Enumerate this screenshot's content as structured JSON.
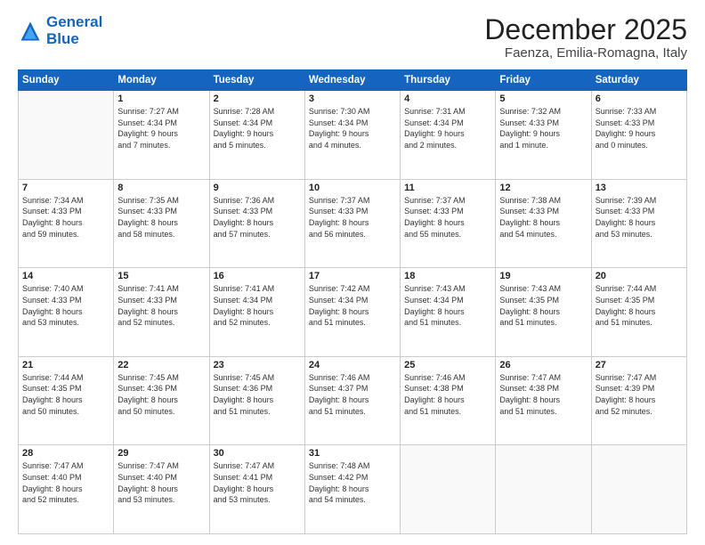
{
  "header": {
    "logo_line1": "General",
    "logo_line2": "Blue",
    "month": "December 2025",
    "location": "Faenza, Emilia-Romagna, Italy"
  },
  "weekdays": [
    "Sunday",
    "Monday",
    "Tuesday",
    "Wednesday",
    "Thursday",
    "Friday",
    "Saturday"
  ],
  "weeks": [
    [
      {
        "day": "",
        "info": ""
      },
      {
        "day": "1",
        "info": "Sunrise: 7:27 AM\nSunset: 4:34 PM\nDaylight: 9 hours\nand 7 minutes."
      },
      {
        "day": "2",
        "info": "Sunrise: 7:28 AM\nSunset: 4:34 PM\nDaylight: 9 hours\nand 5 minutes."
      },
      {
        "day": "3",
        "info": "Sunrise: 7:30 AM\nSunset: 4:34 PM\nDaylight: 9 hours\nand 4 minutes."
      },
      {
        "day": "4",
        "info": "Sunrise: 7:31 AM\nSunset: 4:34 PM\nDaylight: 9 hours\nand 2 minutes."
      },
      {
        "day": "5",
        "info": "Sunrise: 7:32 AM\nSunset: 4:33 PM\nDaylight: 9 hours\nand 1 minute."
      },
      {
        "day": "6",
        "info": "Sunrise: 7:33 AM\nSunset: 4:33 PM\nDaylight: 9 hours\nand 0 minutes."
      }
    ],
    [
      {
        "day": "7",
        "info": "Sunrise: 7:34 AM\nSunset: 4:33 PM\nDaylight: 8 hours\nand 59 minutes."
      },
      {
        "day": "8",
        "info": "Sunrise: 7:35 AM\nSunset: 4:33 PM\nDaylight: 8 hours\nand 58 minutes."
      },
      {
        "day": "9",
        "info": "Sunrise: 7:36 AM\nSunset: 4:33 PM\nDaylight: 8 hours\nand 57 minutes."
      },
      {
        "day": "10",
        "info": "Sunrise: 7:37 AM\nSunset: 4:33 PM\nDaylight: 8 hours\nand 56 minutes."
      },
      {
        "day": "11",
        "info": "Sunrise: 7:37 AM\nSunset: 4:33 PM\nDaylight: 8 hours\nand 55 minutes."
      },
      {
        "day": "12",
        "info": "Sunrise: 7:38 AM\nSunset: 4:33 PM\nDaylight: 8 hours\nand 54 minutes."
      },
      {
        "day": "13",
        "info": "Sunrise: 7:39 AM\nSunset: 4:33 PM\nDaylight: 8 hours\nand 53 minutes."
      }
    ],
    [
      {
        "day": "14",
        "info": "Sunrise: 7:40 AM\nSunset: 4:33 PM\nDaylight: 8 hours\nand 53 minutes."
      },
      {
        "day": "15",
        "info": "Sunrise: 7:41 AM\nSunset: 4:33 PM\nDaylight: 8 hours\nand 52 minutes."
      },
      {
        "day": "16",
        "info": "Sunrise: 7:41 AM\nSunset: 4:34 PM\nDaylight: 8 hours\nand 52 minutes."
      },
      {
        "day": "17",
        "info": "Sunrise: 7:42 AM\nSunset: 4:34 PM\nDaylight: 8 hours\nand 51 minutes."
      },
      {
        "day": "18",
        "info": "Sunrise: 7:43 AM\nSunset: 4:34 PM\nDaylight: 8 hours\nand 51 minutes."
      },
      {
        "day": "19",
        "info": "Sunrise: 7:43 AM\nSunset: 4:35 PM\nDaylight: 8 hours\nand 51 minutes."
      },
      {
        "day": "20",
        "info": "Sunrise: 7:44 AM\nSunset: 4:35 PM\nDaylight: 8 hours\nand 51 minutes."
      }
    ],
    [
      {
        "day": "21",
        "info": "Sunrise: 7:44 AM\nSunset: 4:35 PM\nDaylight: 8 hours\nand 50 minutes."
      },
      {
        "day": "22",
        "info": "Sunrise: 7:45 AM\nSunset: 4:36 PM\nDaylight: 8 hours\nand 50 minutes."
      },
      {
        "day": "23",
        "info": "Sunrise: 7:45 AM\nSunset: 4:36 PM\nDaylight: 8 hours\nand 51 minutes."
      },
      {
        "day": "24",
        "info": "Sunrise: 7:46 AM\nSunset: 4:37 PM\nDaylight: 8 hours\nand 51 minutes."
      },
      {
        "day": "25",
        "info": "Sunrise: 7:46 AM\nSunset: 4:38 PM\nDaylight: 8 hours\nand 51 minutes."
      },
      {
        "day": "26",
        "info": "Sunrise: 7:47 AM\nSunset: 4:38 PM\nDaylight: 8 hours\nand 51 minutes."
      },
      {
        "day": "27",
        "info": "Sunrise: 7:47 AM\nSunset: 4:39 PM\nDaylight: 8 hours\nand 52 minutes."
      }
    ],
    [
      {
        "day": "28",
        "info": "Sunrise: 7:47 AM\nSunset: 4:40 PM\nDaylight: 8 hours\nand 52 minutes."
      },
      {
        "day": "29",
        "info": "Sunrise: 7:47 AM\nSunset: 4:40 PM\nDaylight: 8 hours\nand 53 minutes."
      },
      {
        "day": "30",
        "info": "Sunrise: 7:47 AM\nSunset: 4:41 PM\nDaylight: 8 hours\nand 53 minutes."
      },
      {
        "day": "31",
        "info": "Sunrise: 7:48 AM\nSunset: 4:42 PM\nDaylight: 8 hours\nand 54 minutes."
      },
      {
        "day": "",
        "info": ""
      },
      {
        "day": "",
        "info": ""
      },
      {
        "day": "",
        "info": ""
      }
    ]
  ]
}
